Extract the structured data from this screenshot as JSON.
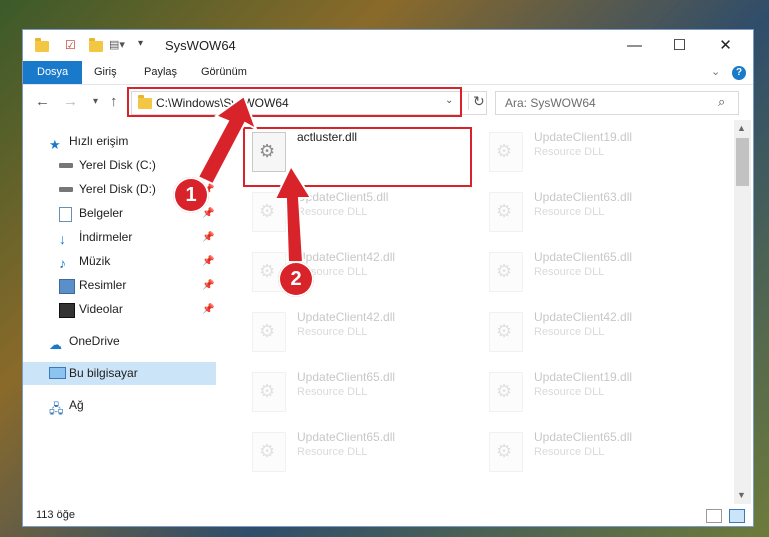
{
  "window": {
    "title": "SysWOW64"
  },
  "ribbon": {
    "tabs": [
      "Dosya",
      "Giriş",
      "Paylaş",
      "Görünüm"
    ]
  },
  "address": {
    "path": "C:\\Windows\\SysWOW64",
    "search_placeholder": "Ara: SysWOW64"
  },
  "sidebar": {
    "items": [
      {
        "label": "Hızlı erişim",
        "icon": "star-icon"
      },
      {
        "label": "Yerel Disk (C:)",
        "icon": "drive-icon"
      },
      {
        "label": "Yerel Disk (D:)",
        "icon": "drive-icon"
      },
      {
        "label": "Belgeler",
        "icon": "documents-icon"
      },
      {
        "label": "İndirmeler",
        "icon": "download-icon"
      },
      {
        "label": "Müzik",
        "icon": "music-icon"
      },
      {
        "label": "Resimler",
        "icon": "pictures-icon"
      },
      {
        "label": "Videolar",
        "icon": "videos-icon"
      },
      {
        "label": "OneDrive",
        "icon": "cloud-icon"
      },
      {
        "label": "Bu bilgisayar",
        "icon": "computer-icon"
      },
      {
        "label": "Ağ",
        "icon": "network-icon"
      }
    ]
  },
  "files": [
    {
      "name": "actluster.dll",
      "type": ""
    },
    {
      "name": "UpdateClient19.dll",
      "type": "Resource DLL"
    },
    {
      "name": "UpdateClient5.dll",
      "type": "Resource DLL"
    },
    {
      "name": "UpdateClient63.dll",
      "type": "Resource DLL"
    },
    {
      "name": "UpdateClient42.dll",
      "type": "Resource DLL"
    },
    {
      "name": "UpdateClient65.dll",
      "type": "Resource DLL"
    },
    {
      "name": "UpdateClient42.dll",
      "type": "Resource DLL"
    },
    {
      "name": "UpdateClient42.dll",
      "type": "Resource DLL"
    },
    {
      "name": "UpdateClient65.dll",
      "type": "Resource DLL"
    },
    {
      "name": "UpdateClient19.dll",
      "type": "Resource DLL"
    },
    {
      "name": "UpdateClient65.dll",
      "type": "Resource DLL"
    },
    {
      "name": "UpdateClient65.dll",
      "type": "Resource DLL"
    }
  ],
  "status": {
    "count": "113 öğe"
  },
  "callouts": {
    "one": "1",
    "two": "2"
  },
  "colors": {
    "accent": "#1979ca",
    "highlight": "#d8232a",
    "selection": "#cce4f7"
  }
}
